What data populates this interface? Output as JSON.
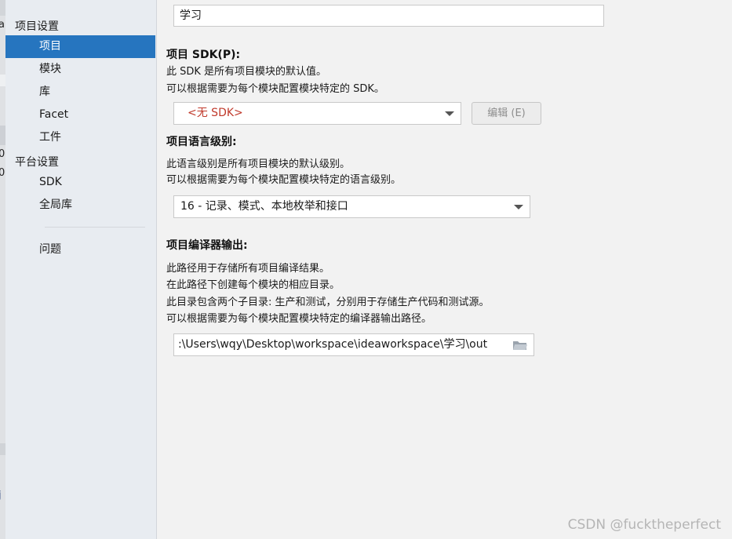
{
  "edge": {
    "glyph_a": "a",
    "glyph_0a": "0",
    "glyph_0b": "0",
    "glyph_j": "j"
  },
  "sidebar": {
    "project_settings_header": "项目设置",
    "project_items": [
      "项目",
      "模块",
      "库",
      "Facet",
      "工件"
    ],
    "platform_settings_header": "平台设置",
    "platform_items": [
      "SDK",
      "全局库"
    ],
    "problems_item": "问题",
    "selected_item": "项目"
  },
  "main": {
    "project_name_value": "学习",
    "sdk": {
      "heading": "项目 SDK(P):",
      "desc1": "此 SDK 是所有项目模块的默认值。",
      "desc2": "可以根据需要为每个模块配置模块特定的 SDK。",
      "selected": "<无 SDK>",
      "edit_button": "编辑 (E)"
    },
    "language_level": {
      "heading": "项目语言级别:",
      "desc1": "此语言级别是所有项目模块的默认级别。",
      "desc2": "可以根据需要为每个模块配置模块特定的语言级别。",
      "selected": "16 - 记录、模式、本地枚举和接口"
    },
    "compiler_output": {
      "heading": "项目编译器输出:",
      "desc1": "此路径用于存储所有项目编译结果。",
      "desc2": "在此路径下创建每个模块的相应目录。",
      "desc3": "此目录包含两个子目录: 生产和测试，分别用于存储生产代码和测试源。",
      "desc4": "可以根据需要为每个模块配置模块特定的编译器输出路径。",
      "path": ":\\Users\\wqy\\Desktop\\workspace\\ideaworkspace\\学习\\out"
    }
  },
  "watermark": "CSDN @fucktheperfect",
  "colors": {
    "selection": "#2675bf",
    "no_sdk_text": "#c0392b",
    "sidebar_bg": "#e8ecf1"
  }
}
